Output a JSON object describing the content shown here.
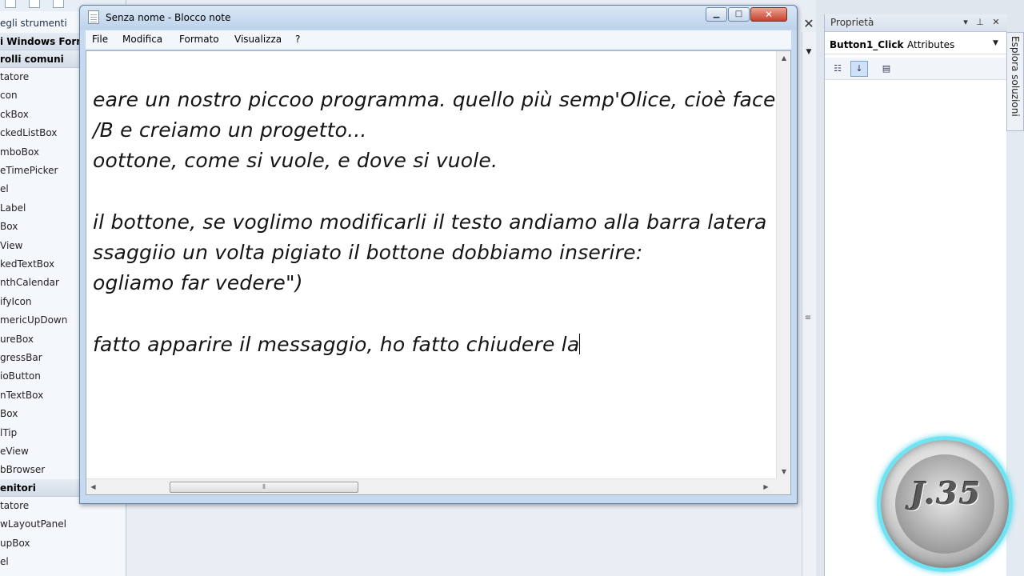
{
  "toolbox": {
    "title": "egli strumenti",
    "section_top": "i Windows Forms",
    "section_common": "rolli comuni",
    "common_items": [
      "tatore",
      "con",
      "ckBox",
      "ckedListBox",
      "mboBox",
      "eTimePicker",
      "el",
      "Label",
      "Box",
      "View",
      "kedTextBox",
      "nthCalendar",
      "ifyIcon",
      "mericUpDown",
      "ureBox",
      "gressBar",
      "ioButton",
      "nTextBox",
      "Box",
      "lTip",
      "eView",
      "bBrowser"
    ],
    "section_containers": "enitori",
    "container_items": [
      "tatore",
      "wLayoutPanel",
      "upBox",
      "el"
    ]
  },
  "properties": {
    "title": "Proprietà",
    "object_name": "Button1_Click",
    "object_type": "Attributes"
  },
  "solution_explorer": {
    "tab_label": "Esplora soluzioni"
  },
  "notepad": {
    "title": "Senza nome - Blocco note",
    "menu": [
      "File",
      "Modifica",
      "Formato",
      "Visualizza",
      "?"
    ],
    "lines": [
      "eare un nostro piccoo programma. quello più semp'Olice, cioè facen",
      "/B e creiamo un progetto...",
      "oottone, come si vuole, e dove si vuole.",
      "",
      "il bottone, se voglimo modificarli il testo andiamo alla barra latera",
      "ssaggiio un volta pigiato il bottone dobbiamo inserire:",
      "ogliamo far vedere\")",
      "",
      "fatto apparire il messaggio, ho fatto chiudere la"
    ]
  },
  "logo": {
    "text": "J.35"
  },
  "icons": {
    "notepad_icon": "notepad-doc-icon",
    "minimize": "minimize-icon",
    "maximize": "maximize-icon",
    "close": "close-icon",
    "scroll_up": "arrow-up-icon",
    "scroll_down": "arrow-down-icon",
    "scroll_left": "arrow-left-icon",
    "scroll_right": "arrow-right-icon",
    "categorized": "categorized-icon",
    "alphabetical": "alphabetical-icon",
    "property_pages": "property-pages-icon",
    "dropdown": "chevron-down-icon",
    "pin": "pin-icon"
  },
  "colors": {
    "titlebar": "#bcd2ea",
    "close_button": "#c5412c",
    "logo_ring": "#6fe3f2"
  }
}
